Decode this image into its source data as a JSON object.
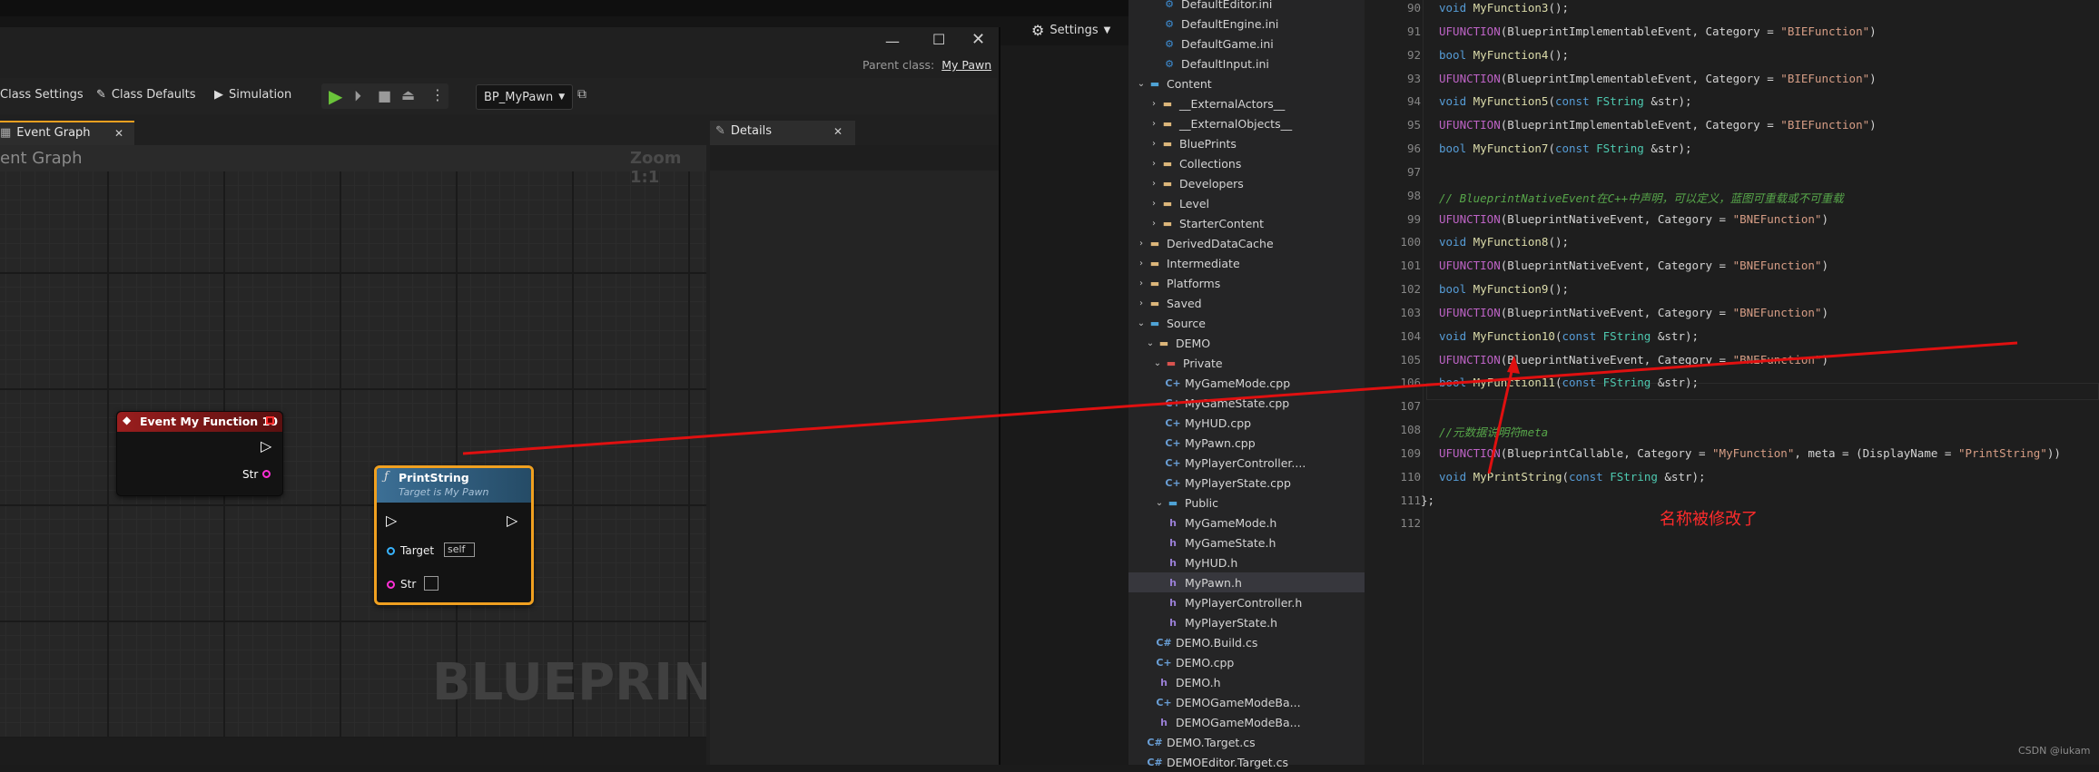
{
  "ue": {
    "settings_label": "Settings",
    "parent_class_label": "Parent class:",
    "parent_class_value": "My Pawn",
    "toolbar": {
      "class_settings": "Class Settings",
      "class_defaults": "Class Defaults",
      "simulation": "Simulation",
      "blueprint_dropdown": "BP_MyPawn"
    },
    "tabs": {
      "event_graph": "Event Graph",
      "details": "Details"
    },
    "graph": {
      "title": "ent Graph",
      "zoom": "Zoom 1:1",
      "watermark": "BLUEPRINT",
      "event_node": {
        "title": "Event My Function 10",
        "str_pin": "Str"
      },
      "print_node": {
        "title": "PrintString",
        "subtitle": "Target is My Pawn",
        "target_label": "Target",
        "target_value": "self",
        "str_label": "Str"
      }
    }
  },
  "solution_explorer": {
    "items": [
      {
        "label": "DefaultEditor.ini",
        "icon": "gear-icon"
      },
      {
        "label": "DefaultEngine.ini",
        "icon": "gear-icon"
      },
      {
        "label": "DefaultGame.ini",
        "icon": "gear-icon"
      },
      {
        "label": "DefaultInput.ini",
        "icon": "gear-icon"
      },
      {
        "label": "Content",
        "icon": "folder-icon",
        "expanded": true
      },
      {
        "label": "__ExternalActors__",
        "icon": "folder-icon"
      },
      {
        "label": "__ExternalObjects__",
        "icon": "folder-icon"
      },
      {
        "label": "BluePrints",
        "icon": "folder-icon"
      },
      {
        "label": "Collections",
        "icon": "folder-icon"
      },
      {
        "label": "Developers",
        "icon": "folder-icon"
      },
      {
        "label": "Level",
        "icon": "folder-icon"
      },
      {
        "label": "StarterContent",
        "icon": "folder-icon"
      },
      {
        "label": "DerivedDataCache",
        "icon": "folder-icon"
      },
      {
        "label": "Intermediate",
        "icon": "folder-icon"
      },
      {
        "label": "Platforms",
        "icon": "folder-icon"
      },
      {
        "label": "Saved",
        "icon": "folder-icon"
      },
      {
        "label": "Source",
        "icon": "folder-icon",
        "expanded": true
      },
      {
        "label": "DEMO",
        "icon": "folder-icon",
        "expanded": true
      },
      {
        "label": "Private",
        "icon": "folder-icon",
        "expanded": true
      },
      {
        "label": "MyGameMode.cpp",
        "icon": "cpp-file-icon"
      },
      {
        "label": "MyGameState.cpp",
        "icon": "cpp-file-icon"
      },
      {
        "label": "MyHUD.cpp",
        "icon": "cpp-file-icon"
      },
      {
        "label": "MyPawn.cpp",
        "icon": "cpp-file-icon"
      },
      {
        "label": "MyPlayerController....",
        "icon": "cpp-file-icon"
      },
      {
        "label": "MyPlayerState.cpp",
        "icon": "cpp-file-icon"
      },
      {
        "label": "Public",
        "icon": "folder-icon",
        "expanded": true
      },
      {
        "label": "MyGameMode.h",
        "icon": "header-file-icon"
      },
      {
        "label": "MyGameState.h",
        "icon": "header-file-icon"
      },
      {
        "label": "MyHUD.h",
        "icon": "header-file-icon"
      },
      {
        "label": "MyPawn.h",
        "icon": "header-file-icon",
        "selected": true
      },
      {
        "label": "MyPlayerController.h",
        "icon": "header-file-icon"
      },
      {
        "label": "MyPlayerState.h",
        "icon": "header-file-icon"
      },
      {
        "label": "DEMO.Build.cs",
        "icon": "csharp-file-icon"
      },
      {
        "label": "DEMO.cpp",
        "icon": "cpp-file-icon"
      },
      {
        "label": "DEMO.h",
        "icon": "header-file-icon"
      },
      {
        "label": "DEMOGameModeBa...",
        "icon": "cpp-file-icon"
      },
      {
        "label": "DEMOGameModeBa...",
        "icon": "header-file-icon"
      },
      {
        "label": "DEMO.Target.cs",
        "icon": "csharp-file-icon"
      },
      {
        "label": "DEMOEditor.Target.cs",
        "icon": "csharp-file-icon"
      }
    ]
  },
  "editor": {
    "lines": [
      {
        "num": "90",
        "text": "void MyFunction3();"
      },
      {
        "num": "91",
        "text": "UFUNCTION(BlueprintImplementableEvent, Category = \"BIEFunction\")"
      },
      {
        "num": "92",
        "text": "bool MyFunction4();"
      },
      {
        "num": "93",
        "text": "UFUNCTION(BlueprintImplementableEvent, Category = \"BIEFunction\")"
      },
      {
        "num": "94",
        "text": "void MyFunction5(const FString &str);"
      },
      {
        "num": "95",
        "text": "UFUNCTION(BlueprintImplementableEvent, Category = \"BIEFunction\")"
      },
      {
        "num": "96",
        "text": "bool MyFunction7(const FString &str);"
      },
      {
        "num": "97",
        "text": ""
      },
      {
        "num": "98",
        "text": "// BlueprintNativeEvent在C++中声明，可以定义，蓝图可重载或不可重载"
      },
      {
        "num": "99",
        "text": "UFUNCTION(BlueprintNativeEvent, Category = \"BNEFunction\")"
      },
      {
        "num": "100",
        "text": "void MyFunction8();"
      },
      {
        "num": "101",
        "text": "UFUNCTION(BlueprintNativeEvent, Category = \"BNEFunction\")"
      },
      {
        "num": "102",
        "text": "bool MyFunction9();"
      },
      {
        "num": "103",
        "text": "UFUNCTION(BlueprintNativeEvent, Category = \"BNEFunction\")"
      },
      {
        "num": "104",
        "text": "void MyFunction10(const FString &str);"
      },
      {
        "num": "105",
        "text": "UFUNCTION(BlueprintNativeEvent, Category = \"BNEFunction\")"
      },
      {
        "num": "106",
        "text": "bool MyFunction11(const FString &str);"
      },
      {
        "num": "107",
        "text": ""
      },
      {
        "num": "108",
        "text": "//元数据说明符meta"
      },
      {
        "num": "109",
        "text": "UFUNCTION(BlueprintCallable, Category = \"MyFunction\", meta = (DisplayName = \"PrintString\"))"
      },
      {
        "num": "110",
        "text": "void MyPrintString(const FString &str);"
      },
      {
        "num": "111",
        "text": "};"
      },
      {
        "num": "112",
        "text": ""
      }
    ],
    "annotation": "名称被修改了",
    "watermark": "CSDN @iukam"
  },
  "colors": {
    "accent": "#f0a020",
    "event_header": "#8e1d1d",
    "annotation": "#ff2b2b"
  }
}
